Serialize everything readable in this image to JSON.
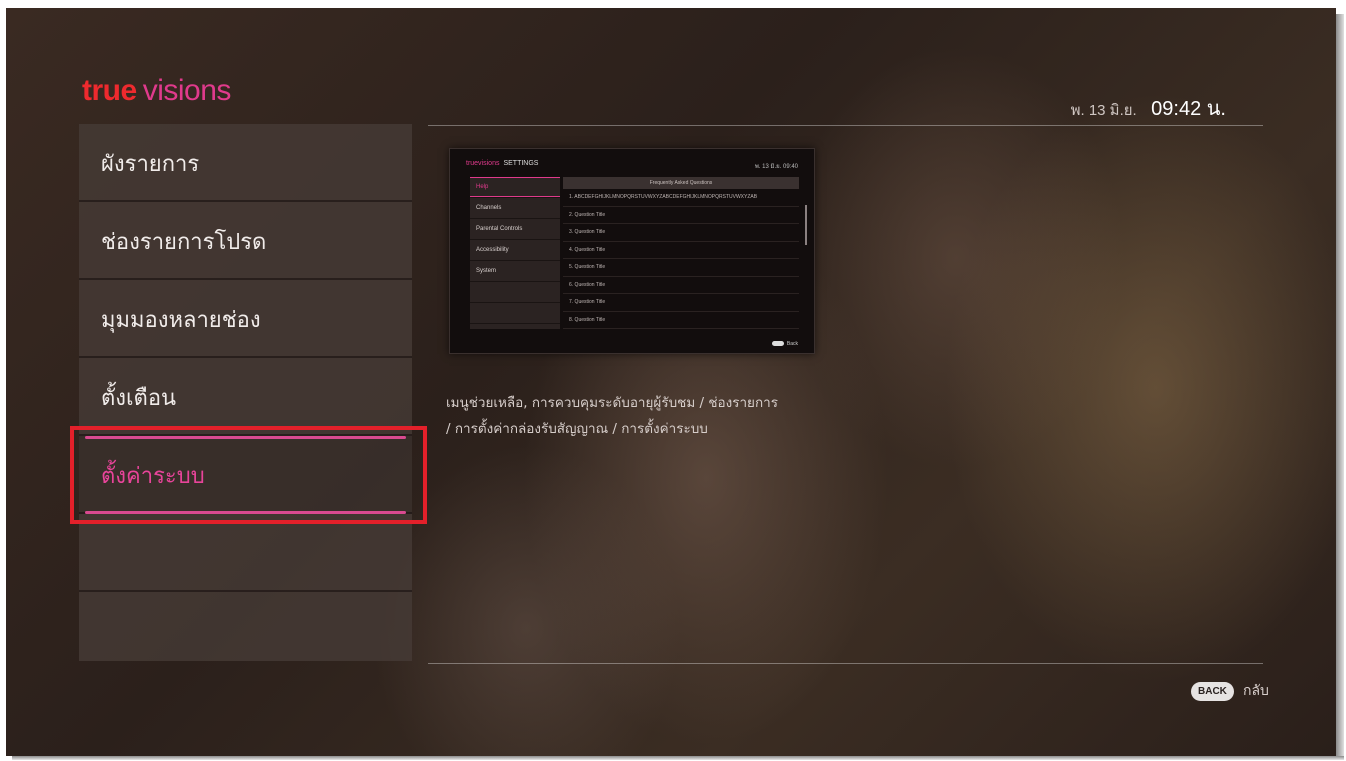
{
  "brand": {
    "true": "true",
    "visions": "visions"
  },
  "datetime": {
    "date": "พ. 13 มิ.ย.",
    "time": "09:42 น."
  },
  "menu": {
    "items": [
      {
        "label": "ผังรายการ"
      },
      {
        "label": "ช่องรายการโปรด"
      },
      {
        "label": "มุมมองหลายช่อง"
      },
      {
        "label": "ตั้งเตือน"
      },
      {
        "label": "ตั้งค่าระบบ",
        "active": true
      },
      {
        "label": ""
      },
      {
        "label": ""
      }
    ]
  },
  "preview": {
    "logo": "truevisions",
    "section": "SETTINGS",
    "clock": "พ. 13 มิ.ย. 09:40",
    "sidebar": [
      "Help",
      "Channels",
      "Parental Controls",
      "Accessibility",
      "System",
      "",
      ""
    ],
    "title": "Frequently Asked Questions",
    "questions": [
      "1. ABCDEFGHIJKLMNOPQRSTUVWXYZABCDEFGHIJKLMNOPQRSTUVWXYZAB",
      "2. Question Title",
      "3. Question Title",
      "4. Question Title",
      "5. Question Title",
      "6. Question Title",
      "7. Question Title",
      "8. Question Title"
    ],
    "back": "Back"
  },
  "description": {
    "line1": "เมนูช่วยเหลือ, การควบคุมระดับอายุผู้รับชม / ช่องรายการ",
    "line2": "/ การตั้งค่ากล่องรับสัญญาณ / การตั้งค่าระบบ"
  },
  "footer": {
    "back_key": "BACK",
    "back_label": "กลับ"
  },
  "colors": {
    "accent": "#e03a8c",
    "brand_red": "#ee2a2e",
    "highlight": "#e3202a"
  }
}
